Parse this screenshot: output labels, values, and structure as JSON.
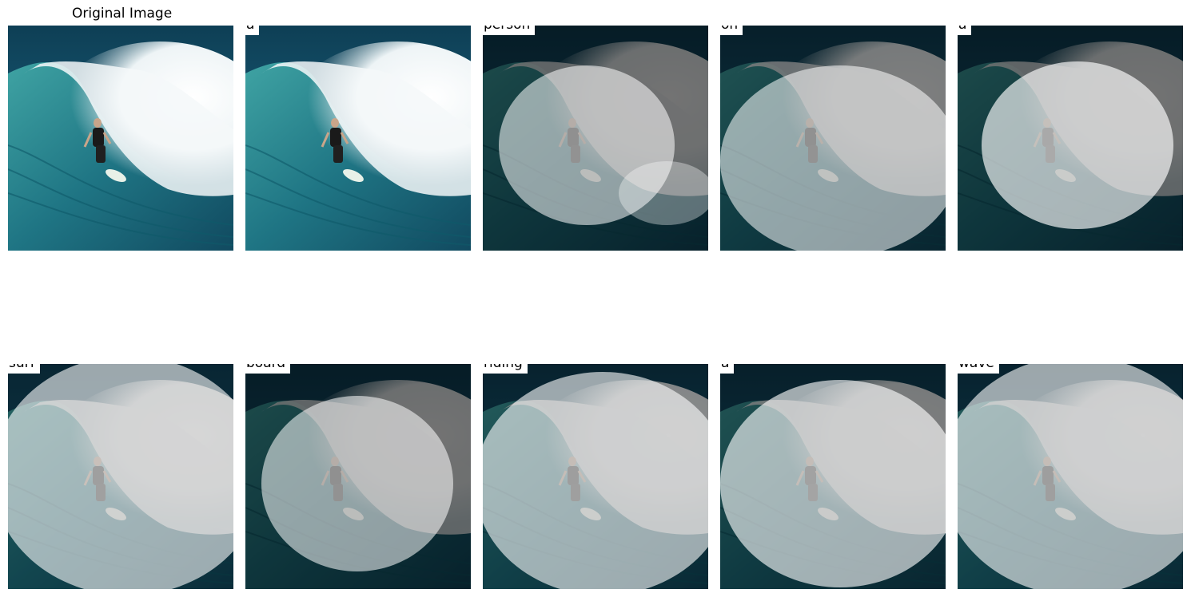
{
  "figure": {
    "original_title": "Original Image",
    "tokens": [
      "a",
      "person",
      "on",
      "a",
      "surf",
      "board",
      "riding",
      "a",
      "wave"
    ]
  },
  "panels": [
    {
      "label": "a",
      "overlay": "none"
    },
    {
      "label": "person",
      "overlay": "center-left"
    },
    {
      "label": "on",
      "overlay": "broad"
    },
    {
      "label": "a",
      "overlay": "center"
    },
    {
      "label": "surf",
      "overlay": "broad"
    },
    {
      "label": "board",
      "overlay": "center"
    },
    {
      "label": "riding",
      "overlay": "broad"
    },
    {
      "label": "a",
      "overlay": "broad"
    },
    {
      "label": "wave",
      "overlay": "broad"
    }
  ],
  "colors": {
    "ocean_dark": "#0e3f55",
    "ocean_mid": "#1f6f7e",
    "foam": "#f2f6f7",
    "wave_face": "#2e8a8f",
    "surfer": "#1a1a1a"
  }
}
